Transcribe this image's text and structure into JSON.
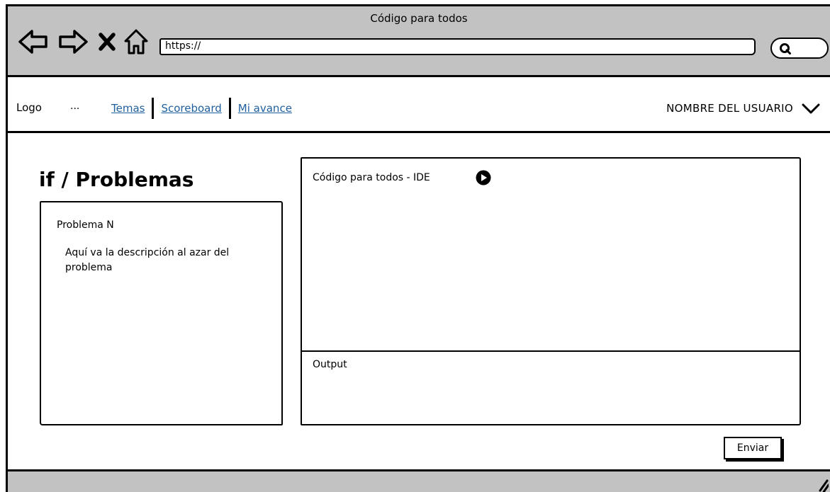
{
  "window": {
    "title": "Código para todos",
    "url": "https://"
  },
  "toolbar": {
    "icons": [
      "back-arrow-icon",
      "forward-arrow-icon",
      "close-x-icon",
      "home-icon",
      "search-icon"
    ]
  },
  "header": {
    "logo": "Logo",
    "ellipsis": "...",
    "nav": [
      "Temas",
      "Scoreboard",
      "Mi avance"
    ],
    "user_name": "NOMBRE DEL USUARIO"
  },
  "main": {
    "page_title": "if / Problemas",
    "problem": {
      "title": "Problema N",
      "description": "Aquí va la descripción al azar del problema"
    },
    "ide": {
      "title": "Código para todos - IDE"
    },
    "output": {
      "title": "Output"
    },
    "submit_label": "Enviar"
  },
  "colors": {
    "chrome": "#c2c2c2",
    "link": "#1f5f9e"
  }
}
